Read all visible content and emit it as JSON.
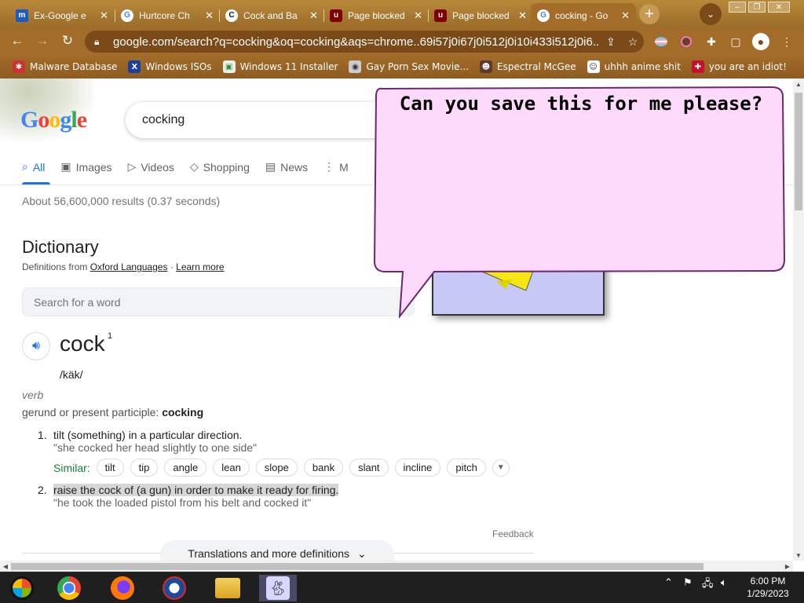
{
  "browser": {
    "tabs": [
      {
        "label": "Ex-Google e",
        "favicon": "m-icon",
        "color": "#1d5bbf"
      },
      {
        "label": "Hurtcore Ch",
        "favicon": "google-icon",
        "color": "#ffffff"
      },
      {
        "label": "Cock and Ba",
        "favicon": "c-icon",
        "color": "#111111"
      },
      {
        "label": "Page blocked",
        "favicon": "ublock-icon",
        "color": "#800000"
      },
      {
        "label": "Page blocked",
        "favicon": "ublock-icon",
        "color": "#800000"
      },
      {
        "label": "cocking - Go",
        "favicon": "google-icon",
        "color": "#ffffff",
        "active": true
      }
    ],
    "url": "google.com/search?q=cocking&oq=cocking&aqs=chrome..69i57j0i67j0i512j0i10i433i512j0i6...",
    "bookmarks": [
      {
        "label": "Malware Database",
        "icon": "bug-icon"
      },
      {
        "label": "Windows ISOs",
        "icon": "x-icon"
      },
      {
        "label": "Windows 11 Installer",
        "icon": "image-icon"
      },
      {
        "label": "Gay Porn Sex Movie...",
        "icon": "disk-icon"
      },
      {
        "label": "Espectral McGee",
        "icon": "avatar-icon"
      },
      {
        "label": "uhhh anime shit",
        "icon": "anime-icon"
      },
      {
        "label": "you are an idiot!",
        "icon": "flag-icon"
      }
    ]
  },
  "google": {
    "logo": "Google",
    "query": "cocking",
    "nav": [
      {
        "label": "All",
        "icon": "search-icon"
      },
      {
        "label": "Images",
        "icon": "image-icon"
      },
      {
        "label": "Videos",
        "icon": "play-icon"
      },
      {
        "label": "Shopping",
        "icon": "tag-icon"
      },
      {
        "label": "News",
        "icon": "news-icon"
      },
      {
        "label": "M",
        "icon": "more-icon"
      }
    ],
    "stats": "About 56,600,000 results (0.37 seconds)",
    "dictionary": {
      "title": "Dictionary",
      "source_prefix": "Definitions from",
      "source": "Oxford Languages",
      "learn_more": "Learn more",
      "search_placeholder": "Search for a word",
      "word": "cock",
      "superscript": "1",
      "phonetic": "/käk/",
      "pos": "verb",
      "form_label": "gerund or present participle:",
      "form": "cocking",
      "definitions": [
        {
          "num": "1.",
          "text": "tilt (something) in a particular direction.",
          "example": "\"she cocked her head slightly to one side\""
        },
        {
          "num": "2.",
          "text": "raise the cock of (a gun) in order to make it ready for firing.",
          "example": "\"he took the loaded pistol from his belt and cocked it\""
        }
      ],
      "similar_label": "Similar:",
      "similar": [
        "tilt",
        "tip",
        "angle",
        "lean",
        "slope",
        "bank",
        "slant",
        "incline",
        "pitch"
      ],
      "feedback": "Feedback",
      "more": "Translations and more definitions"
    }
  },
  "bonzi": {
    "bubble_text": "Can you save this for me please?"
  },
  "taskbar": {
    "time": "6:00 PM",
    "date": "1/29/2023",
    "icons": [
      "start-icon",
      "chrome-icon",
      "firefox-icon",
      "obama-icon",
      "file-explorer-icon",
      "bunny-icon"
    ]
  }
}
